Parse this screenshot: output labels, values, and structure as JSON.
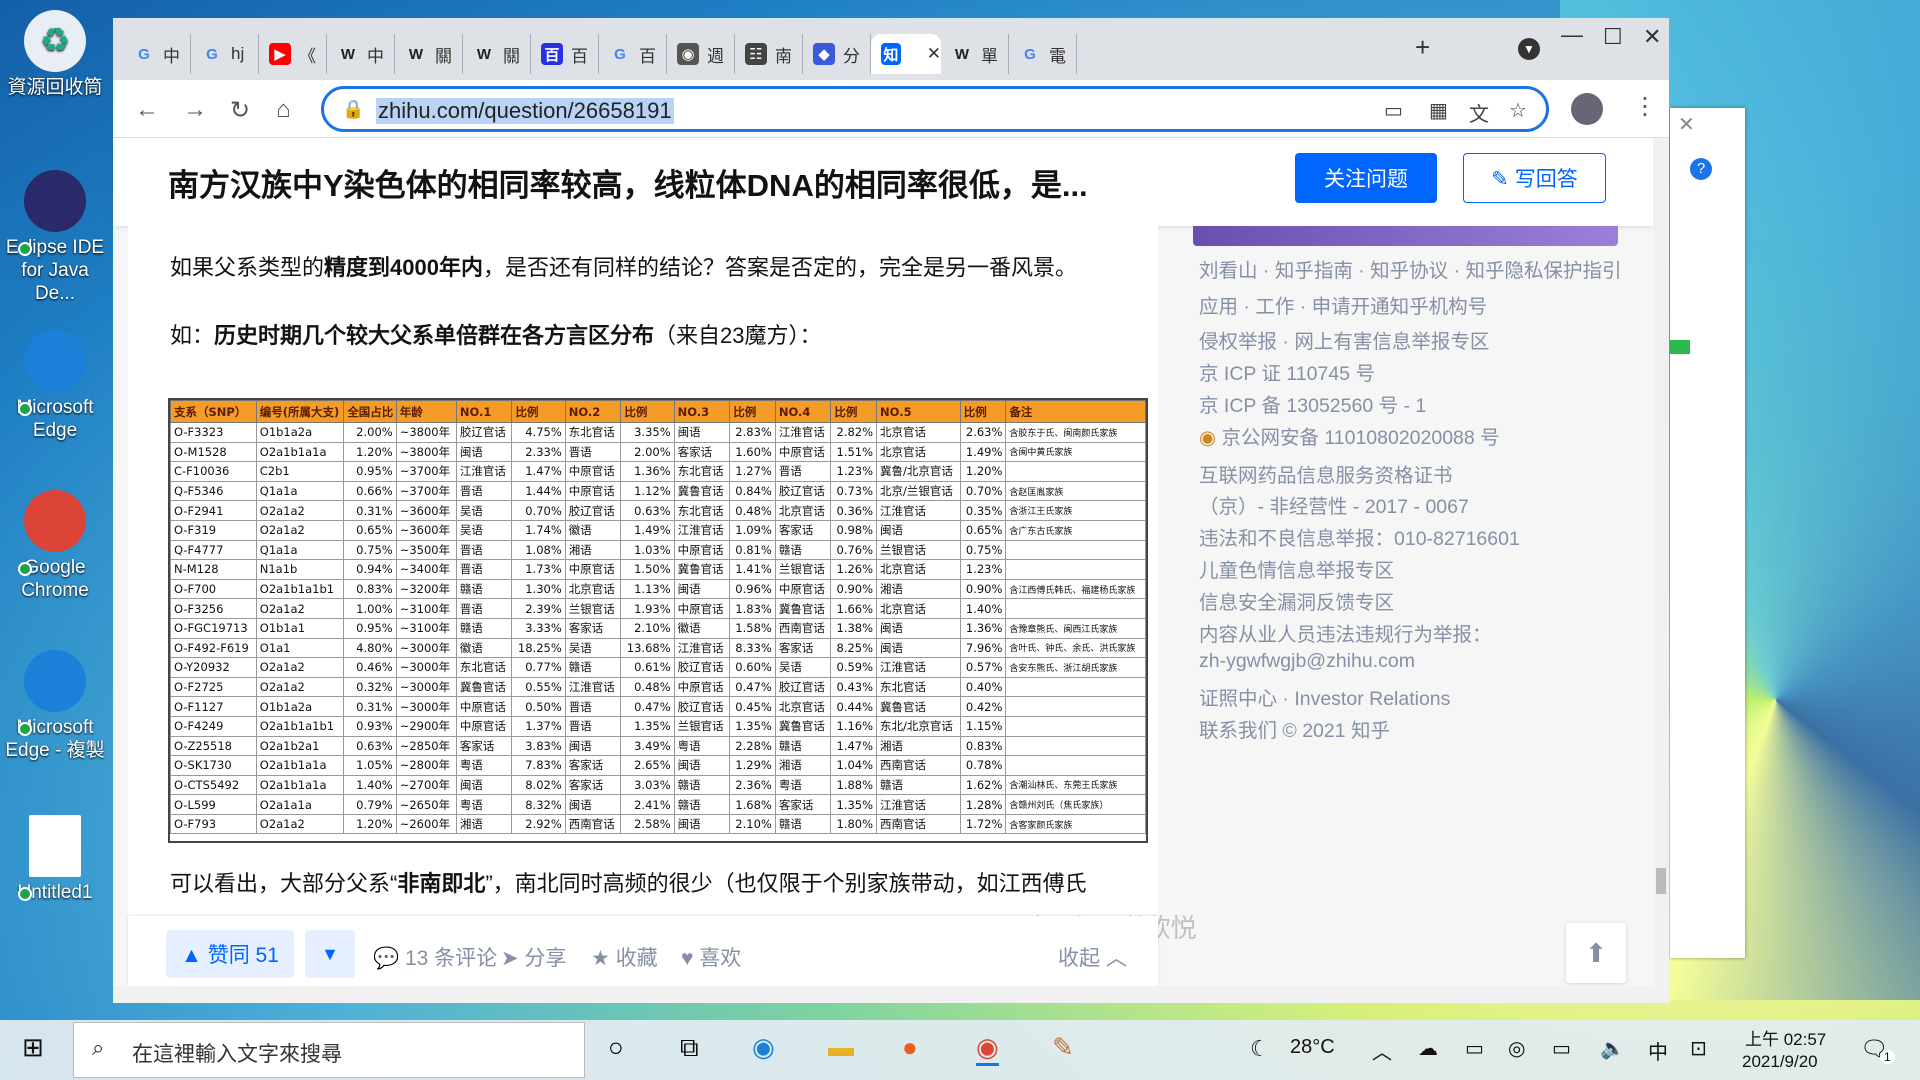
{
  "desktop": {
    "icons": [
      {
        "label": "資源回收筒",
        "glyph": "♻"
      },
      {
        "label": "Eclipse IDE for Java De...",
        "glyph": ""
      },
      {
        "label": "Microsoft Edge",
        "glyph": ""
      },
      {
        "label": "Google Chrome",
        "glyph": ""
      },
      {
        "label": "Microsoft Edge - 複製",
        "glyph": ""
      },
      {
        "label": "Untitled1",
        "glyph": ""
      }
    ]
  },
  "browser": {
    "tabs": [
      {
        "favicon": "G",
        "color": "#4285f4",
        "label": "中"
      },
      {
        "favicon": "G",
        "color": "#4285f4",
        "label": "hj"
      },
      {
        "favicon": "▶",
        "color": "#f00",
        "label": "《"
      },
      {
        "favicon": "W",
        "color": "#222",
        "label": "中"
      },
      {
        "favicon": "W",
        "color": "#222",
        "label": "關"
      },
      {
        "favicon": "W",
        "color": "#222",
        "label": "關"
      },
      {
        "favicon": "百",
        "color": "#2932e1",
        "label": "百"
      },
      {
        "favicon": "G",
        "color": "#4285f4",
        "label": "百"
      },
      {
        "favicon": "◉",
        "color": "#555",
        "label": "週"
      },
      {
        "favicon": "☷",
        "color": "#444",
        "label": "南"
      },
      {
        "favicon": "◆",
        "color": "#3a5bd9",
        "label": "分"
      },
      {
        "favicon": "知",
        "color": "#0066ff",
        "label": ""
      },
      {
        "favicon": "W",
        "color": "#222",
        "label": "單"
      },
      {
        "favicon": "G",
        "color": "#4285f4",
        "label": "電"
      }
    ],
    "url": "zhihu.com/question/26658191"
  },
  "question": {
    "title": "南方汉族中Y染色体的相同率较高，线粒体DNA的相同率很低，是...",
    "follow_label": "关注问题",
    "write_label": "写回答"
  },
  "article": {
    "p1_a": "如果父系类型的",
    "p1_b": "精度到4000年内",
    "p1_c": "，是否还有同样的结论？答案是否定的，完全是另一番风景。",
    "p2_a": "如：",
    "p2_b": "历史时期几个较大父系单倍群在各方言区分布",
    "p2_c": "（来自23魔方）：",
    "p3_a": "可以看出，大部分父系“",
    "p3_b": "非南即北",
    "p3_c": "”，南北同时高频的很少（也仅限于个别家族带动，如江西傅氏",
    "watermark": "知乎 @谌欣悦"
  },
  "table": {
    "headers": [
      "支系（SNP）",
      "编号(所属大支)",
      "全国占比",
      "年龄",
      "NO.1",
      "比例",
      "NO.2",
      "比例",
      "NO.3",
      "比例",
      "NO.4",
      "比例",
      "NO.5",
      "比例",
      "备注"
    ],
    "rows": [
      [
        "O-F3323",
        "O1b1a2a",
        "2.00%",
        "~3800年",
        "胶辽官话",
        "4.75%",
        "东北官话",
        "3.35%",
        "闽语",
        "2.83%",
        "江淮官话",
        "2.82%",
        "北京官话",
        "2.63%",
        "含胶东于氏、闽南颜氏家族"
      ],
      [
        "O-M1528",
        "O2a1b1a1a",
        "1.20%",
        "~3800年",
        "闽语",
        "2.33%",
        "晋语",
        "2.00%",
        "客家话",
        "1.60%",
        "中原官话",
        "1.51%",
        "北京官话",
        "1.49%",
        "含闽中黄氏家族"
      ],
      [
        "C-F10036",
        "C2b1",
        "0.95%",
        "~3700年",
        "江淮官话",
        "1.47%",
        "中原官话",
        "1.36%",
        "东北官话",
        "1.27%",
        "晋语",
        "1.23%",
        "冀鲁/北京官话",
        "1.20%",
        ""
      ],
      [
        "Q-F5346",
        "Q1a1a",
        "0.66%",
        "~3700年",
        "晋语",
        "1.44%",
        "中原官话",
        "1.12%",
        "冀鲁官话",
        "0.84%",
        "胶辽官话",
        "0.73%",
        "北京/兰银官话",
        "0.70%",
        "含赵匡胤家族"
      ],
      [
        "O-F2941",
        "O2a1a2",
        "0.31%",
        "~3600年",
        "吴语",
        "0.70%",
        "胶辽官话",
        "0.63%",
        "东北官话",
        "0.48%",
        "北京官话",
        "0.36%",
        "江淮官话",
        "0.35%",
        "含浙江王氏家族"
      ],
      [
        "O-F319",
        "O2a1a2",
        "0.65%",
        "~3600年",
        "吴语",
        "1.74%",
        "徽语",
        "1.49%",
        "江淮官话",
        "1.09%",
        "客家话",
        "0.98%",
        "闽语",
        "0.65%",
        "含广东古氏家族"
      ],
      [
        "Q-F4777",
        "Q1a1a",
        "0.75%",
        "~3500年",
        "晋语",
        "1.08%",
        "湘语",
        "1.03%",
        "中原官话",
        "0.81%",
        "赣语",
        "0.76%",
        "兰银官话",
        "0.75%",
        ""
      ],
      [
        "N-M128",
        "N1a1b",
        "0.94%",
        "~3400年",
        "晋语",
        "1.73%",
        "中原官话",
        "1.50%",
        "冀鲁官话",
        "1.41%",
        "兰银官话",
        "1.26%",
        "北京官话",
        "1.23%",
        ""
      ],
      [
        "O-F700",
        "O2a1b1a1b1",
        "0.83%",
        "~3200年",
        "赣语",
        "1.30%",
        "北京官话",
        "1.13%",
        "闽语",
        "0.96%",
        "中原官话",
        "0.90%",
        "湘语",
        "0.90%",
        "含江西傅氏韩氏、福建杨氏家族"
      ],
      [
        "O-F3256",
        "O2a1a2",
        "1.00%",
        "~3100年",
        "晋语",
        "2.39%",
        "兰银官话",
        "1.93%",
        "中原官话",
        "1.83%",
        "冀鲁官话",
        "1.66%",
        "北京官话",
        "1.40%",
        ""
      ],
      [
        "O-FGC19713",
        "O1b1a1",
        "0.95%",
        "~3100年",
        "赣语",
        "3.33%",
        "客家话",
        "2.10%",
        "徽语",
        "1.58%",
        "西南官话",
        "1.38%",
        "闽语",
        "1.36%",
        "含豫章熊氏、闽西江氏家族"
      ],
      [
        "O-F492-F619",
        "O1a1",
        "4.80%",
        "~3000年",
        "徽语",
        "18.25%",
        "吴语",
        "13.68%",
        "江淮官话",
        "8.33%",
        "客家话",
        "8.25%",
        "闽语",
        "7.96%",
        "含叶氏、钟氏、余氏、洪氏家族"
      ],
      [
        "O-Y20932",
        "O2a1a2",
        "0.46%",
        "~3000年",
        "东北官话",
        "0.77%",
        "赣语",
        "0.61%",
        "胶辽官话",
        "0.60%",
        "吴语",
        "0.59%",
        "江淮官话",
        "0.57%",
        "含安东熊氏、浙江胡氏家族"
      ],
      [
        "O-F2725",
        "O2a1a2",
        "0.32%",
        "~3000年",
        "冀鲁官话",
        "0.55%",
        "江淮官话",
        "0.48%",
        "中原官话",
        "0.47%",
        "胶辽官话",
        "0.43%",
        "东北官话",
        "0.40%",
        ""
      ],
      [
        "O-F1127",
        "O1b1a2a",
        "0.31%",
        "~3000年",
        "中原官话",
        "0.50%",
        "晋语",
        "0.47%",
        "胶辽官话",
        "0.45%",
        "北京官话",
        "0.44%",
        "冀鲁官话",
        "0.42%",
        ""
      ],
      [
        "O-F4249",
        "O2a1b1a1b1",
        "0.93%",
        "~2900年",
        "中原官话",
        "1.37%",
        "晋语",
        "1.35%",
        "兰银官话",
        "1.35%",
        "冀鲁官话",
        "1.16%",
        "东北/北京官话",
        "1.15%",
        ""
      ],
      [
        "O-Z25518",
        "O2a1b2a1",
        "0.63%",
        "~2850年",
        "客家话",
        "3.83%",
        "闽语",
        "3.49%",
        "粤语",
        "2.28%",
        "赣语",
        "1.47%",
        "湘语",
        "0.83%",
        ""
      ],
      [
        "O-SK1730",
        "O2a1b1a1a",
        "1.05%",
        "~2800年",
        "粤语",
        "7.83%",
        "客家话",
        "2.65%",
        "闽语",
        "1.29%",
        "湘语",
        "1.04%",
        "西南官话",
        "0.78%",
        ""
      ],
      [
        "O-CTS5492",
        "O2a1b1a1a",
        "1.40%",
        "~2700年",
        "闽语",
        "8.02%",
        "客家话",
        "3.03%",
        "赣语",
        "2.36%",
        "粤语",
        "1.88%",
        "赣语",
        "1.62%",
        "含潮汕林氏、东莞王氏家族"
      ],
      [
        "O-L599",
        "O2a1a1a",
        "0.79%",
        "~2650年",
        "粤语",
        "8.32%",
        "闽语",
        "2.41%",
        "赣语",
        "1.68%",
        "客家话",
        "1.35%",
        "江淮官话",
        "1.28%",
        "含赣州刘氏（焦氏家族）"
      ],
      [
        "O-F793",
        "O2a1a2",
        "1.20%",
        "~2600年",
        "湘语",
        "2.92%",
        "西南官话",
        "2.58%",
        "闽语",
        "2.10%",
        "赣语",
        "1.80%",
        "西南官话",
        "1.72%",
        "含客家颜氏家族"
      ]
    ]
  },
  "actions": {
    "vote": "▲ 赞同 51",
    "down": "▼",
    "comments": "💬 13 条评论",
    "share": "➤ 分享",
    "collect": "★ 收藏",
    "like": "♥ 喜欢",
    "collapse": "收起 ︿"
  },
  "sidebar": [
    "刘看山 · 知乎指南 · 知乎协议 · 知乎隐私保护指引",
    "应用 · 工作 · 申请开通知乎机构号",
    "侵权举报 · 网上有害信息举报专区",
    "京 ICP 证 110745 号",
    "京 ICP 备 13052560 号 - 1",
    "京公网安备 11010802020088 号",
    "互联网药品信息服务资格证书",
    "（京）- 非经营性 - 2017 - 0067",
    "违法和不良信息举报：010-82716601",
    "儿童色情信息举报专区",
    "信息安全漏洞反馈专区",
    "内容从业人员违法违规行为举报：",
    "zh-ygwfwgjb@zhihu.com",
    "证照中心 · Investor Relations",
    "联系我们 © 2021 知乎"
  ],
  "taskbar": {
    "search_placeholder": "在這裡輸入文字來搜尋",
    "weather": "28°C",
    "ime": "中",
    "time": "上午 02:57",
    "date": "2021/9/20",
    "notif_count": "1"
  }
}
